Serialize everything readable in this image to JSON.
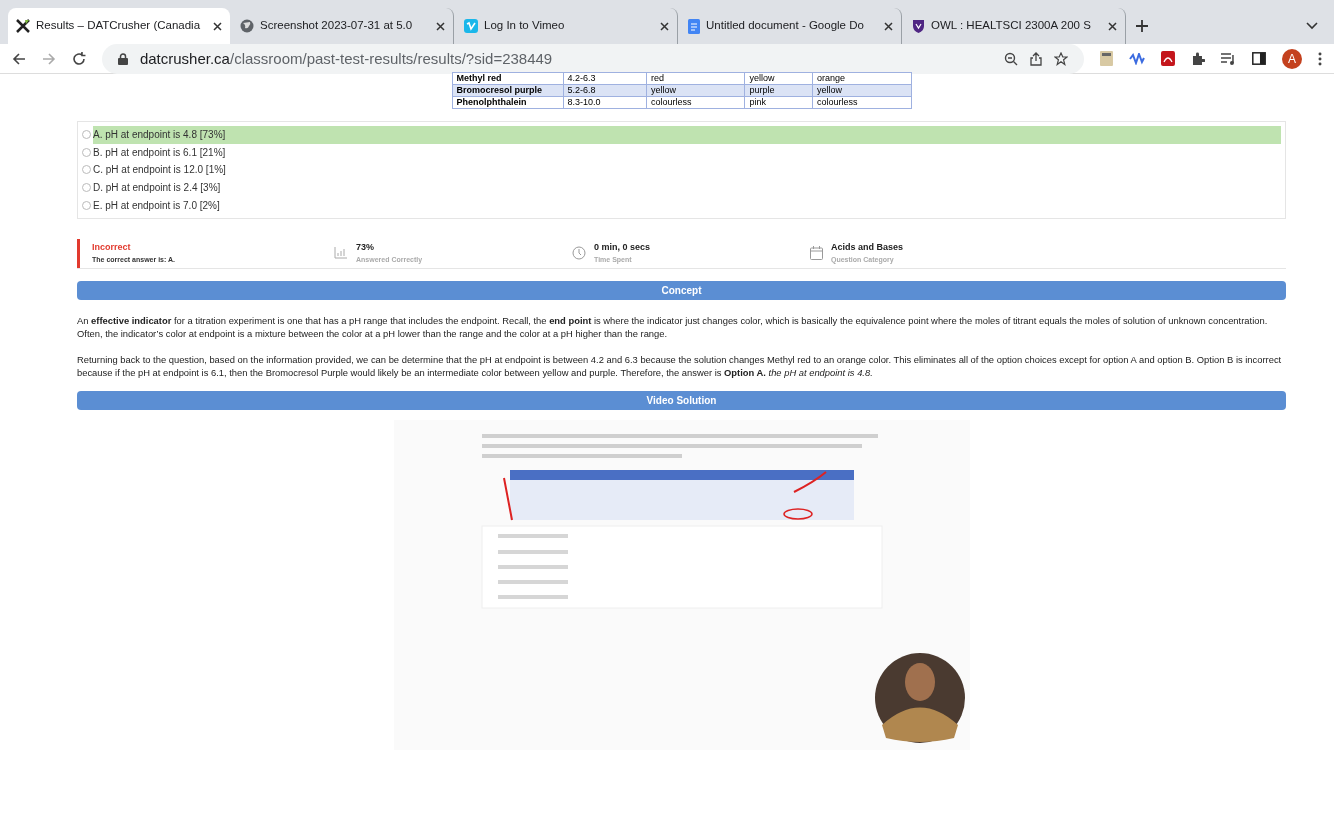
{
  "browser": {
    "tabs": [
      {
        "kind": "logo",
        "title": "Results – DATCrusher (Canadia",
        "selected": true
      },
      {
        "kind": "globe",
        "title": "Screenshot 2023-07-31 at 5.0",
        "selected": false
      },
      {
        "kind": "vimeo",
        "title": "Log In to Vimeo",
        "selected": false
      },
      {
        "kind": "doc",
        "title": "Untitled document - Google Do",
        "selected": false
      },
      {
        "kind": "shield",
        "title": "OWL : HEALTSCI 2300A 200 S",
        "selected": false
      }
    ],
    "url_host": "datcrusher.ca",
    "url_path": "/classroom/past-test-results/results/?sid=238449",
    "avatar": "A"
  },
  "indicator_table": {
    "rows": [
      {
        "cells": [
          "Methyl red",
          "4.2-6.3",
          "red",
          "yellow",
          "orange"
        ],
        "highlighted": false
      },
      {
        "cells": [
          "Bromocresol purple",
          "5.2-6.8",
          "yellow",
          "purple",
          "yellow"
        ],
        "highlighted": true
      },
      {
        "cells": [
          "Phenolphthalein",
          "8.3-10.0",
          "colourless",
          "pink",
          "colourless"
        ],
        "highlighted": false
      }
    ]
  },
  "options": [
    {
      "label": "A. pH at endpoint is 4.8 [73%]",
      "correct": true,
      "selected": false
    },
    {
      "label": "B. pH at endpoint is 6.1 [21%]",
      "correct": false,
      "selected": false
    },
    {
      "label": "C. pH at endpoint is 12.0 [1%]",
      "correct": false,
      "selected": false
    },
    {
      "label": "D. pH at endpoint is 2.4 [3%]",
      "correct": false,
      "selected": false
    },
    {
      "label": "E. pH at endpoint is 7.0 [2%]",
      "correct": false,
      "selected": false
    }
  ],
  "result": {
    "status": "Incorrect",
    "correct_answer": "The correct answer is: A."
  },
  "stats": [
    {
      "kind": "chart",
      "value": "73%",
      "label": "Answered Correctly"
    },
    {
      "kind": "clock",
      "value": "0 min, 0 secs",
      "label": "Time Spent"
    },
    {
      "kind": "calendar",
      "value": "Acids and Bases",
      "label": "Question Category"
    }
  ],
  "concept": {
    "title": "Concept",
    "paragraphs": [
      "An **effective indicator** for a titration experiment is one that has a pH range that includes the endpoint. Recall, the **end point** is where the indicator just changes color, which is basically the equivalence point where the moles of titrant equals the moles of solution of unknown concentration. Often, the indicator’s color at endpoint is a mixture between the color at a pH lower than the range and the color at a pH higher than the range.",
      "Returning back to the question, based on the information provided, we can be determine that the pH at endpoint is between 4.2 and 6.3 because the solution changes Methyl red to an orange color. This eliminates all of the option choices except for option A and option B. Option B is incorrect because if the pH at endpoint is 6.1, then the Bromocresol Purple would likely be an intermediate color between yellow and purple. Therefore, the answer is **Option A.** *the pH at endpoint is 4.8.*"
    ]
  },
  "video": {
    "title": "Video Solution",
    "kind": "picture"
  }
}
